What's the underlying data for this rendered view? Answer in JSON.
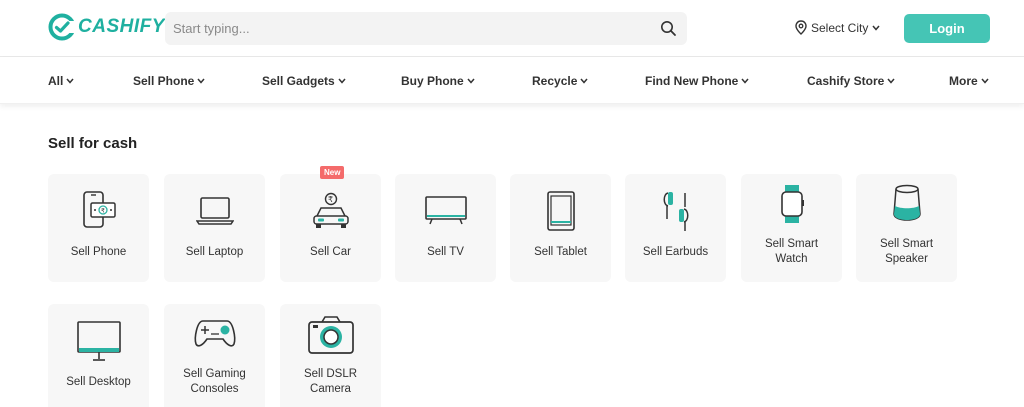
{
  "header": {
    "logo_text": "CASHIFY",
    "search_placeholder": "Start typing...",
    "city_label": "Select City",
    "login_label": "Login",
    "brand_color": "#1fb0a0",
    "accent_color": "#45c5b5"
  },
  "nav": {
    "items": [
      {
        "label": "All"
      },
      {
        "label": "Sell Phone"
      },
      {
        "label": "Sell Gadgets"
      },
      {
        "label": "Buy Phone"
      },
      {
        "label": "Recycle"
      },
      {
        "label": "Find New Phone"
      },
      {
        "label": "Cashify Store"
      },
      {
        "label": "More"
      }
    ]
  },
  "main": {
    "section_title": "Sell for cash",
    "new_badge": "New",
    "cards": [
      {
        "line1": "Sell Phone",
        "line2": "",
        "icon": "phone-cash-icon"
      },
      {
        "line1": "Sell Laptop",
        "line2": "",
        "icon": "laptop-icon"
      },
      {
        "line1": "Sell Car",
        "line2": "",
        "icon": "car-icon"
      },
      {
        "line1": "Sell TV",
        "line2": "",
        "icon": "tv-icon"
      },
      {
        "line1": "Sell Tablet",
        "line2": "",
        "icon": "tablet-icon"
      },
      {
        "line1": "Sell Earbuds",
        "line2": "",
        "icon": "earbuds-icon"
      },
      {
        "line1": "Sell Smart",
        "line2": "Watch",
        "icon": "smartwatch-icon"
      },
      {
        "line1": "Sell Smart",
        "line2": "Speaker",
        "icon": "smart-speaker-icon"
      },
      {
        "line1": "Sell Desktop",
        "line2": "",
        "icon": "desktop-icon"
      },
      {
        "line1": "Sell Gaming",
        "line2": "Consoles",
        "icon": "gamepad-icon"
      },
      {
        "line1": "Sell DSLR",
        "line2": "Camera",
        "icon": "camera-icon"
      }
    ]
  }
}
